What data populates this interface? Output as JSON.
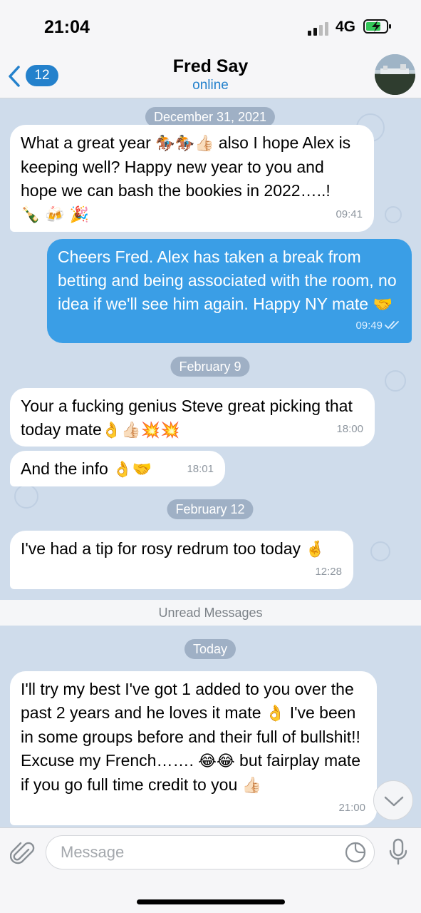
{
  "status": {
    "time": "21:04",
    "network": "4G"
  },
  "header": {
    "back_count": "12",
    "title": "Fred Say",
    "subtitle": "online"
  },
  "messages": [
    {
      "date": "December 31, 2021"
    },
    {
      "dir": "in",
      "text1": "What a great year ",
      "emoji1": "🏇🏇👍🏻",
      "text2": " also I hope Alex is keeping well? Happy new year to you and hope we can bash the bookies in 2022…..! ",
      "emoji2": "🍾 🍻 🎉",
      "time": "09:41"
    },
    {
      "dir": "out",
      "text": "Cheers Fred. Alex has taken a break from betting and being associated with the room, no idea if we'll see him again. Happy NY mate ",
      "emoji": "🤝",
      "time": "09:49"
    },
    {
      "date": "February 9"
    },
    {
      "dir": "in",
      "text": "Your a fucking genius Steve great picking that today mate",
      "emoji": "👌👍🏻💥💥",
      "time": "18:00"
    },
    {
      "dir": "in",
      "text": "And the info ",
      "emoji": "👌🤝",
      "time": "18:01"
    },
    {
      "date": "February 12"
    },
    {
      "dir": "in",
      "text": "I've had a tip for rosy redrum too today ",
      "emoji": "🤞",
      "time": "12:28"
    },
    {
      "unread": "Unread Messages"
    },
    {
      "date": "Today"
    },
    {
      "dir": "in",
      "text1": "I'll try my best I've got 1 added to you over the past 2 years and he loves it mate ",
      "emoji1": "👌",
      "text2": " I've been in some groups before and their full of bullshit!! Excuse my French……. ",
      "emoji2": "😂😂",
      "text3": " but fairplay mate if you go full time credit to you ",
      "emoji3": "👍🏻",
      "time": "21:00"
    }
  ],
  "input": {
    "placeholder": "Message"
  },
  "icons": [
    "back-chevron-icon",
    "signal-icon",
    "battery-charging-icon",
    "paperclip-icon",
    "sticker-icon",
    "microphone-icon",
    "chevron-down-icon",
    "double-check-icon"
  ],
  "colors": {
    "accent": "#2481cc",
    "outgoing_bubble": "#3a9ee6",
    "incoming_bubble": "#ffffff",
    "wallpaper": "#cfdceb"
  }
}
